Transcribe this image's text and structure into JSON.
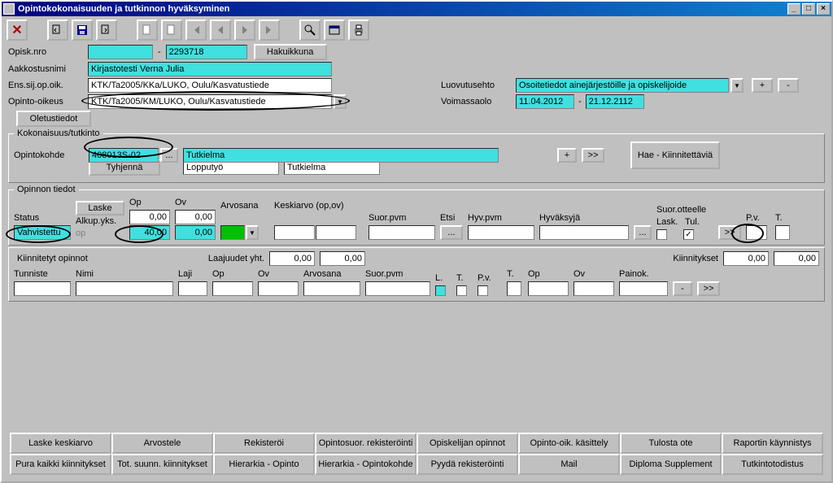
{
  "window": {
    "title": "Opintokokonaisuuden ja tutkinnon hyväksyminen"
  },
  "header": {
    "opisk_nro_label": "Opisk.nro",
    "opisk_sep": "-",
    "opisk_nro": "2293718",
    "hakuikkuna": "Hakuikkuna",
    "aakkostusnimi_label": "Aakkostusnimi",
    "aakkostusnimi": "Kirjastotesti Verna Julia",
    "ens_label": "Ens.sij.op.oik.",
    "ens_value": "KTK/Ta2005/KKa/LUKO, Oulu/Kasvatustiede",
    "opinto_oikeus_label": "Opinto-oikeus",
    "opinto_oikeus": "KTK/Ta2005/KM/LUKO, Oulu/Kasvatustiede",
    "luovutusehto_label": "Luovutusehto",
    "luovutusehto": "Osoitetiedot ainejärjestöille ja opiskelijoide",
    "voimassaolo_label": "Voimassaolo",
    "voimassaolo_from": "11.04.2012",
    "voimassaolo_sep": "-",
    "voimassaolo_to": "21.12.2112",
    "plus": "+",
    "minus": "-",
    "oletustiedot": "Oletustiedot"
  },
  "kok": {
    "legend": "Kokonaisuus/tutkinto",
    "opintokohde_label": "Opintokohde",
    "code": "408013S-02",
    "dots": "...",
    "name": "Tutkielma",
    "plus": "+",
    "next": ">>",
    "hae": "Hae - Kiinnitettäviä",
    "tyhjenna": "Tyhjennä",
    "lopputyo": "Lopputyö",
    "tutkielma2": "Tutkielma"
  },
  "op": {
    "legend": "Opinnon tiedot",
    "laske": "Laske",
    "status_label": "Status",
    "status": "Vahvistettu",
    "alkup_label": "Alkup.yks.",
    "alkup": "0,00",
    "op_label": "Op",
    "op_val": "40,00",
    "op2_label": "op",
    "ov_label": "Ov",
    "ov": "0,00",
    "ov2": "0,00",
    "arvosana_label": "Arvosana",
    "keskiarvo_label": "Keskiarvo (op,ov)",
    "suorpvm_label": "Suor.pvm",
    "etsi_label": "Etsi",
    "hyvpvm_label": "Hyv.pvm",
    "hyvaksyja_label": "Hyväksyjä",
    "suorott_label": "Suor.otteelle",
    "lask_label": "Lask.",
    "tul_label": "Tul.",
    "pv_label": "P.v.",
    "t_label": "T.",
    "next": ">>",
    "dots": "..."
  },
  "kp": {
    "legend": "Kiinnitetyt opinnot",
    "laaj_label": "Laajuudet yht.",
    "laaj1": "0,00",
    "laaj2": "0,00",
    "kiin_label": "Kiinnitykset",
    "kiin1": "0,00",
    "kiin2": "0,00",
    "tunniste": "Tunniste",
    "nimi": "Nimi",
    "laji": "Laji",
    "op": "Op",
    "ov": "Ov",
    "arvosana": "Arvosana",
    "suorpvm": "Suor.pvm",
    "l": "L.",
    "t": "T.",
    "pv": "P.v.",
    "t2": "T.",
    "op2": "Op",
    "ov2": "Ov",
    "painok": "Painok.",
    "minus": "-",
    "next": ">>"
  },
  "buttons": {
    "r1": [
      "Laske keskiarvo",
      "Arvostele",
      "Rekisteröi",
      "Opintosuor. rekisteröinti",
      "Opiskelijan opinnot",
      "Opinto-oik. käsittely",
      "Tulosta ote",
      "Raportin käynnistys"
    ],
    "r2": [
      "Pura kaikki kiinnitykset",
      "Tot. suunn. kiinnitykset",
      "Hierarkia - Opinto",
      "Hierarkia - Opintokohde",
      "Pyydä rekisteröinti",
      "Mail",
      "Diploma Supplement",
      "Tutkintotodistus"
    ]
  }
}
